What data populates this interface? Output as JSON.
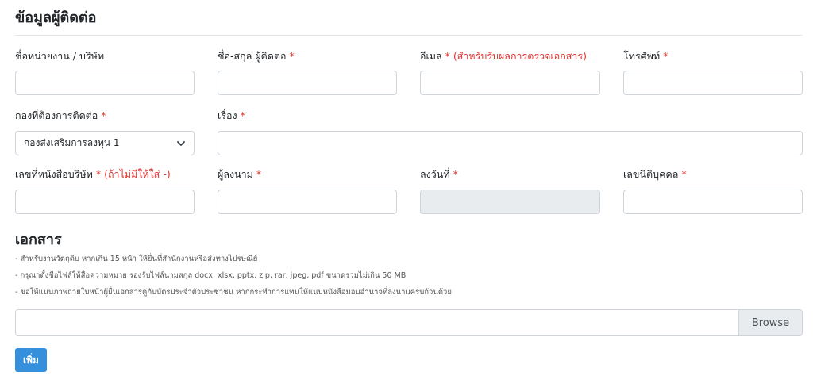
{
  "contact": {
    "title": "ข้อมูลผู้ติดต่อ",
    "company": {
      "label": "ชื่อหน่วยงาน / บริษัท",
      "value": ""
    },
    "name": {
      "label": "ชื่อ-สกุล ผู้ติดต่อ",
      "required": "*",
      "value": ""
    },
    "email": {
      "label": "อีเมล",
      "required": "*",
      "note": "(สำหรับรับผลการตรวจเอกสาร)",
      "value": ""
    },
    "phone": {
      "label": "โทรศัพท์",
      "required": "*",
      "value": ""
    },
    "division": {
      "label": "กองที่ต้องการติดต่อ",
      "required": "*",
      "selected": "กองส่งเสริมการลงทุน 1"
    },
    "subject": {
      "label": "เรื่อง",
      "required": "*",
      "value": ""
    },
    "letter_no": {
      "label": "เลขที่หนังสือบริษัท",
      "required": "*",
      "note": "(ถ้าไม่มีให้ใส่ -)",
      "value": ""
    },
    "signer": {
      "label": "ผู้ลงนาม",
      "required": "*",
      "value": ""
    },
    "sign_date": {
      "label": "ลงวันที่",
      "required": "*",
      "value": ""
    },
    "juristic_id": {
      "label": "เลขนิติบุคคล",
      "required": "*",
      "value": ""
    }
  },
  "documents": {
    "title": "เอกสาร",
    "hints": [
      "- สำหรับงานวัตถุดิบ หากเกิน 15 หน้า ให้ยื่นที่สำนักงานหรือส่งทางไปรษณีย์",
      "- กรุณาตั้งชื่อไฟล์ให้สื่อความหมาย รองรับไฟล์นามสกุล docx, xlsx, pptx, zip, rar, jpeg, pdf ขนาดรวมไม่เกิน 50 MB",
      "- ขอให้แนบภาพถ่ายใบหน้าผู้ยื่นเอกสารคู่กับบัตรประจำตัวประชาชน หากกระทำการแทนให้แนบหนังสือมอบอำนาจที่ลงนามครบถ้วนด้วย"
    ],
    "file_value": "",
    "browse_label": "Browse",
    "add_label": "เพิ่ม"
  }
}
